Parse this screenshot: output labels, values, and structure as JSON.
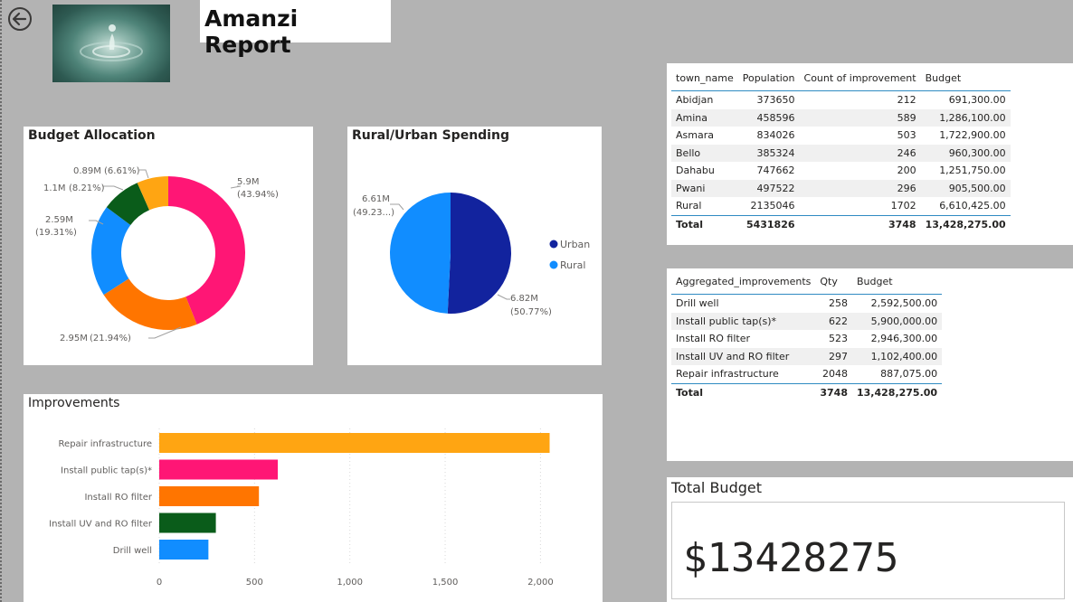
{
  "header": {
    "title": "Amanzi Report",
    "back_icon": "back-arrow-icon",
    "logo_desc": "water-drop-logo"
  },
  "colors": {
    "pink": "#ff1675",
    "orange": "#ff7500",
    "blue": "#118dff",
    "darkgreen": "#0a5c1a",
    "amber": "#ffa512",
    "navy": "#12239e",
    "accent_line": "#2f8bc2"
  },
  "budget_allocation": {
    "title": "Budget Allocation",
    "labels": [
      {
        "value": "5.9M",
        "pct": "(43.94%)"
      },
      {
        "value": "2.95M",
        "pct": "(21.94%)"
      },
      {
        "value": "2.59M",
        "pct": "(19.31%)"
      },
      {
        "value": "1.1M",
        "pct": "(8.21%)"
      },
      {
        "value": "0.89M",
        "pct": "(6.61%)"
      }
    ]
  },
  "rural_urban": {
    "title": "Rural/Urban Spending",
    "labels": [
      {
        "value": "6.82M",
        "pct": "(50.77%)"
      },
      {
        "value": "6.61M",
        "pct": "(49.23...)"
      }
    ],
    "legend": [
      "Urban",
      "Rural"
    ]
  },
  "improvements_chart": {
    "title": "Improvements"
  },
  "chart_data": [
    {
      "type": "pie",
      "title": "Budget Allocation",
      "donut": true,
      "slices": [
        {
          "value": 5.9,
          "percent": 43.94,
          "color": "#ff1675"
        },
        {
          "value": 2.95,
          "percent": 21.94,
          "color": "#ff7500"
        },
        {
          "value": 2.59,
          "percent": 19.31,
          "color": "#118dff"
        },
        {
          "value": 1.1,
          "percent": 8.21,
          "color": "#0a5c1a"
        },
        {
          "value": 0.89,
          "percent": 6.61,
          "color": "#ffa512"
        }
      ],
      "unit": "M"
    },
    {
      "type": "pie",
      "title": "Rural/Urban Spending",
      "slices": [
        {
          "name": "Urban",
          "value": 6.82,
          "percent": 50.77,
          "color": "#12239e"
        },
        {
          "name": "Rural",
          "value": 6.61,
          "percent": 49.23,
          "color": "#118dff"
        }
      ],
      "legend": [
        "Urban",
        "Rural"
      ],
      "legend_position": "right",
      "unit": "M"
    },
    {
      "type": "bar",
      "orientation": "horizontal",
      "title": "Improvements",
      "categories": [
        "Repair infrastructure",
        "Install public tap(s)*",
        "Install RO filter",
        "Install UV and RO filter",
        "Drill well"
      ],
      "values": [
        2048,
        622,
        523,
        297,
        258
      ],
      "colors": [
        "#ffa512",
        "#ff1675",
        "#ff7500",
        "#0a5c1a",
        "#118dff"
      ],
      "xlim": [
        0,
        2150
      ],
      "xticks": [
        "0",
        "500",
        "1,000",
        "1,500",
        "2,000"
      ],
      "xtick_values": [
        0,
        500,
        1000,
        1500,
        2000
      ],
      "grid": "vertical-dotted"
    }
  ],
  "town_table": {
    "columns": [
      "town_name",
      "Population",
      "Count of improvement",
      "Budget"
    ],
    "rows": [
      [
        "Abidjan",
        "373650",
        "212",
        "691,300.00"
      ],
      [
        "Amina",
        "458596",
        "589",
        "1,286,100.00"
      ],
      [
        "Asmara",
        "834026",
        "503",
        "1,722,900.00"
      ],
      [
        "Bello",
        "385324",
        "246",
        "960,300.00"
      ],
      [
        "Dahabu",
        "747662",
        "200",
        "1,251,750.00"
      ],
      [
        "Pwani",
        "497522",
        "296",
        "905,500.00"
      ],
      [
        "Rural",
        "2135046",
        "1702",
        "6,610,425.00"
      ]
    ],
    "total": [
      "Total",
      "5431826",
      "3748",
      "13,428,275.00"
    ]
  },
  "improvements_table": {
    "columns": [
      "Aggregated_improvements",
      "Qty",
      "Budget"
    ],
    "rows": [
      [
        "Drill well",
        "258",
        "2,592,500.00"
      ],
      [
        "Install public tap(s)*",
        "622",
        "5,900,000.00"
      ],
      [
        "Install RO filter",
        "523",
        "2,946,300.00"
      ],
      [
        "Install UV and RO filter",
        "297",
        "1,102,400.00"
      ],
      [
        "Repair infrastructure",
        "2048",
        "887,075.00"
      ]
    ],
    "total": [
      "Total",
      "3748",
      "13,428,275.00"
    ]
  },
  "total_budget": {
    "title": "Total Budget",
    "value": "$13428275"
  }
}
